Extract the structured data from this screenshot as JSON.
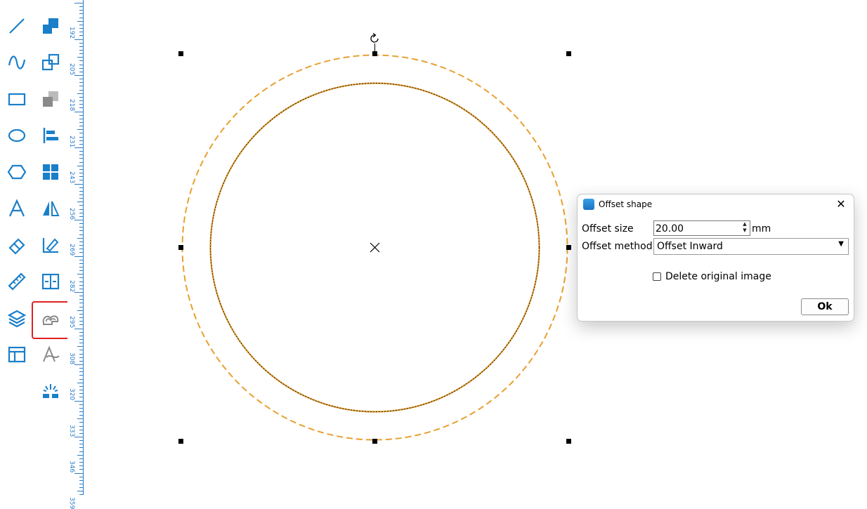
{
  "toolbar": {
    "left_column": [
      "line-icon",
      "curve-icon",
      "rectangle-icon",
      "ellipse-icon",
      "hexagon-icon",
      "text-icon",
      "eraser-icon",
      "ruler-measure-icon",
      "layers-icon",
      "layout-icon"
    ],
    "right_column": [
      "bring-front-icon",
      "duplicate-icon",
      "send-back-icon",
      "align-left-icon",
      "grid-icon",
      "mirror-icon",
      "edit-node-icon",
      "distribute-icon",
      "offset-shape-icon",
      "pen-icon",
      "laser-icon"
    ],
    "active_tool": "offset-shape-icon",
    "colors": {
      "icon": "#1a7fc9",
      "active_border": "#e02020",
      "offset_gray": "#8a8a8a"
    }
  },
  "ruler": {
    "labels": [
      "192",
      "205",
      "218",
      "231",
      "243",
      "256",
      "269",
      "282",
      "295",
      "308",
      "320",
      "333",
      "346",
      "359"
    ]
  },
  "canvas": {
    "colors": {
      "outer_circle": "#e8a030",
      "inner_circle": "#e8a030",
      "inner_stroke": "#222222",
      "handles": "#000000"
    }
  },
  "dialog": {
    "title": "Offset shape",
    "close_glyph": "✕",
    "offset_size_label": "Offset size",
    "offset_size_value": "20.00",
    "unit": "mm",
    "offset_method_label": "Offset method",
    "offset_method_value": "Offset Inward",
    "delete_original_label": "Delete original image",
    "delete_original_checked": false,
    "ok_label": "Ok"
  }
}
